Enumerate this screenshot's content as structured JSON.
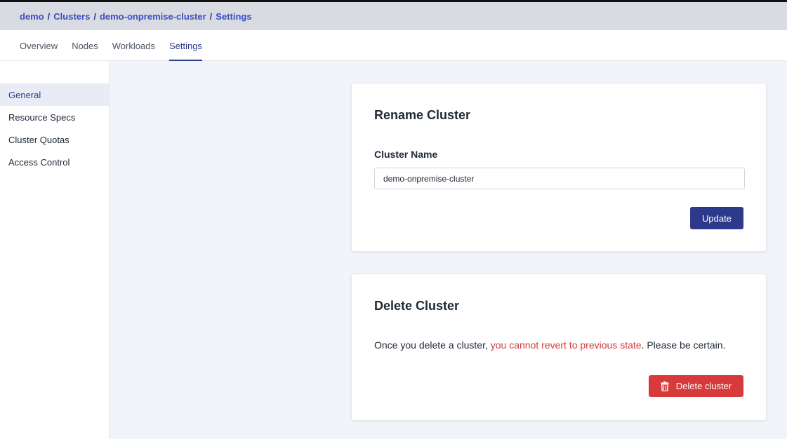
{
  "breadcrumb": [
    "demo",
    "Clusters",
    "demo-onpremise-cluster",
    "Settings"
  ],
  "breadcrumb_separator": "/",
  "tabs": [
    {
      "label": "Overview",
      "active": false
    },
    {
      "label": "Nodes",
      "active": false
    },
    {
      "label": "Workloads",
      "active": false
    },
    {
      "label": "Settings",
      "active": true
    }
  ],
  "sidebar": {
    "items": [
      {
        "label": "General",
        "active": true
      },
      {
        "label": "Resource Specs",
        "active": false
      },
      {
        "label": "Cluster Quotas",
        "active": false
      },
      {
        "label": "Access Control",
        "active": false
      }
    ]
  },
  "rename_card": {
    "title": "Rename Cluster",
    "field_label": "Cluster Name",
    "field_value": "demo-onpremise-cluster",
    "button_label": "Update"
  },
  "delete_card": {
    "title": "Delete Cluster",
    "warning_prefix": "Once you delete a cluster, ",
    "warning_emphasis": "you cannot revert to previous state",
    "warning_suffix": ". Please be certain.",
    "button_label": "Delete cluster",
    "button_icon": "trash-icon"
  },
  "colors": {
    "primary": "#2d3a8c",
    "link": "#3a4cc4",
    "danger": "#d63a3a",
    "header_bg": "#d9dbe3",
    "main_bg": "#f1f4f9"
  }
}
